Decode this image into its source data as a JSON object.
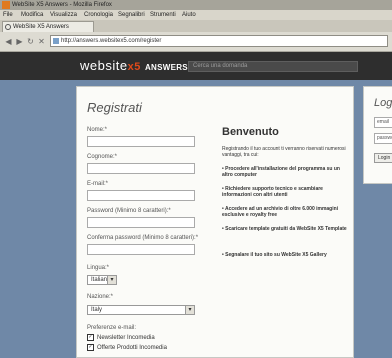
{
  "window": {
    "title": "WebSite X5 Answers - Mozilla Firefox"
  },
  "menu": [
    "File",
    "Modifica",
    "Visualizza",
    "Cronologia",
    "Segnalibri",
    "Strumenti",
    "Aiuto"
  ],
  "tab": {
    "label": "WebSite X5 Answers"
  },
  "nav": {
    "url": "http://answers.websitex5.com/register"
  },
  "header": {
    "logo_main": "website",
    "logo_x5": "x5",
    "logo_sub": "ANSWERS",
    "search_placeholder": "Cerca una domanda"
  },
  "register": {
    "title": "Registrati",
    "fields": {
      "name": "Nome:*",
      "surname": "Cognome:*",
      "email": "E-mail:*",
      "password": "Password (Minimo 8 caratteri):*",
      "confirm": "Conferma password (Minimo 8 caratteri):*"
    },
    "language_label": "Lingua:*",
    "language_value": "Italian",
    "nation_label": "Nazione:*",
    "nation_value": "Italy",
    "prefs_label": "Preferenze e-mail:",
    "pref_newsletter": "Newsletter Incomedia",
    "pref_offers": "Offerte Prodotti Incomedia"
  },
  "welcome": {
    "title": "Benvenuto",
    "intro": "Registrando il tuo account ti verranno riservati numerosi vantaggi, tra cui:",
    "bullets": [
      "Procedere all'installazione del programma su un altro computer",
      "Richiedere supporto tecnico e scambiare informazioni con altri utenti",
      "Accedere ad un archivio di oltre 6.000 immagini esclusive e royalty free",
      "Scaricare template gratuiti da WebSite X5 Template",
      "Segnalare il tuo sito su WebSite X5 Gallery"
    ]
  },
  "login": {
    "title": "Login",
    "email": "email",
    "password": "password",
    "button": "Login"
  }
}
